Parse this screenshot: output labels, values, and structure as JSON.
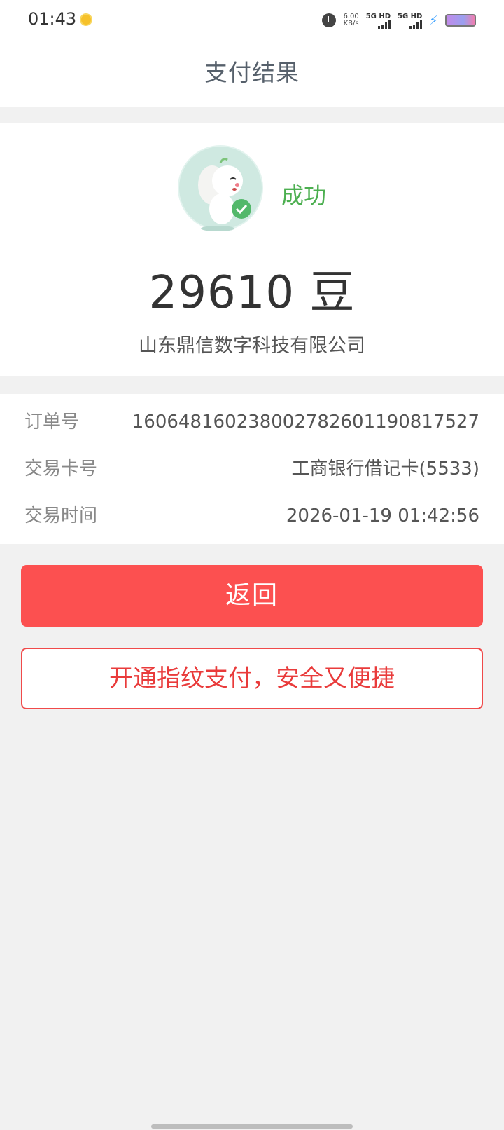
{
  "status_bar": {
    "time": "01:43",
    "net_speed_value": "6.00",
    "net_speed_unit": "KB/s",
    "sim1_label": "5G HD",
    "sim2_label": "5G HD"
  },
  "header": {
    "title": "支付结果"
  },
  "result": {
    "status": "成功",
    "status_color": "#4caf50",
    "amount": "29610 豆",
    "merchant": "山东鼎信数字科技有限公司"
  },
  "details": [
    {
      "label": "订单号",
      "value": "16064816023800278260119081​7527"
    },
    {
      "label": "交易卡号",
      "value": "工商银行借记卡(5533)"
    },
    {
      "label": "交易时间",
      "value": "2026-01-19 01:42:56"
    }
  ],
  "actions": {
    "back_label": "返回",
    "fingerprint_label": "开通指纹支付，安全又便捷",
    "primary_color": "#fc5050"
  },
  "icons": [
    "coin-icon",
    "alarm-icon",
    "signal-icon",
    "bolt-icon",
    "battery-icon",
    "mascot-icon",
    "check-icon"
  ]
}
